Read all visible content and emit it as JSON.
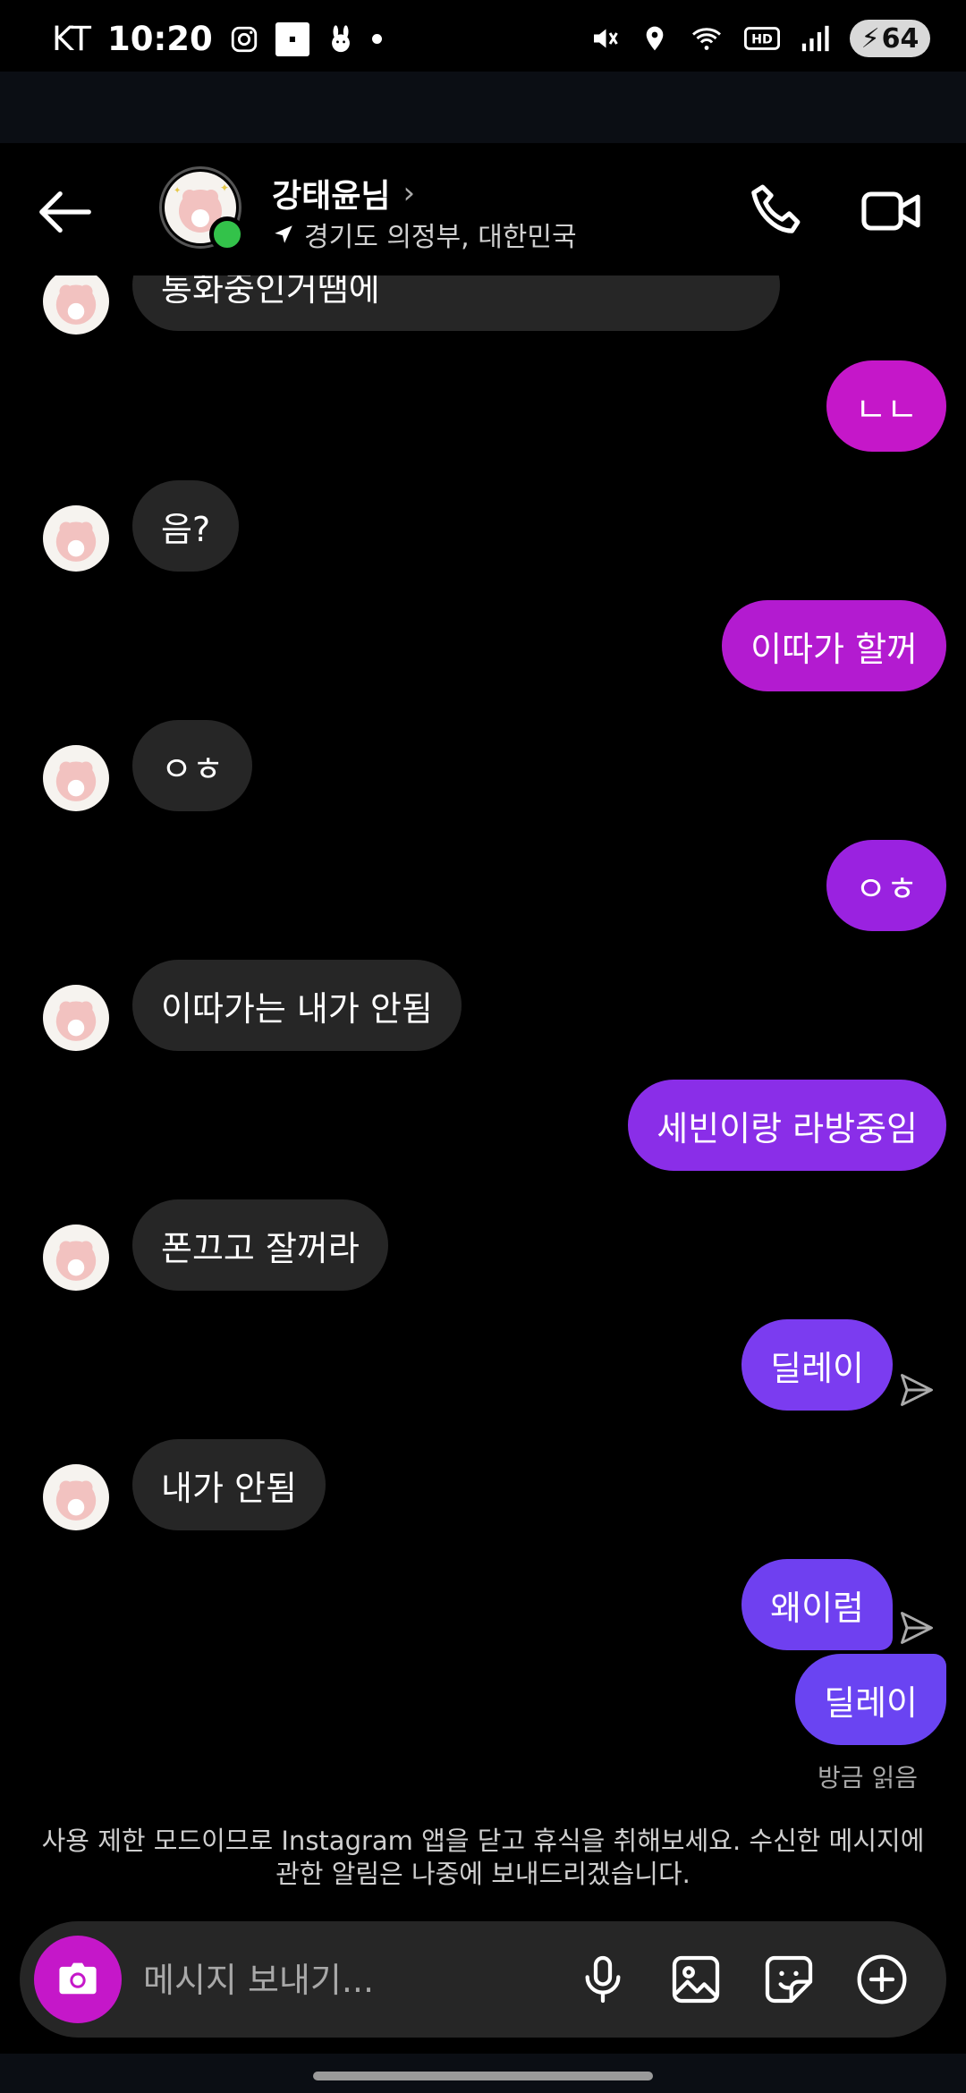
{
  "status_bar": {
    "carrier": "KT",
    "time": "10:20",
    "battery": "64"
  },
  "header": {
    "name": "강태윤님",
    "location": "경기도 의정부, 대한민국"
  },
  "messages": [
    {
      "from": "them",
      "text": "통화중인거땜에"
    },
    {
      "from": "me",
      "text": "ㄴㄴ"
    },
    {
      "from": "them",
      "text": "음?"
    },
    {
      "from": "me",
      "text": "이따가 할꺼"
    },
    {
      "from": "them",
      "text": "ㅇㅎ"
    },
    {
      "from": "me",
      "text": "ㅇㅎ"
    },
    {
      "from": "them",
      "text": "이따가는 내가 안됨"
    },
    {
      "from": "me",
      "text": "세빈이랑 라방중임"
    },
    {
      "from": "them",
      "text": "폰끄고 잘꺼라"
    },
    {
      "from": "me",
      "text": "딜레이"
    },
    {
      "from": "them",
      "text": "내가 안됨"
    },
    {
      "from": "me",
      "text": "왜이럼"
    },
    {
      "from": "me",
      "text": "딜레이"
    }
  ],
  "read_receipt": "방금 읽음",
  "notice": "사용 제한 모드이므로 Instagram 앱을 닫고 휴식을 취해보세요. 수신한 메시지에 관한 알림은 나중에 보내드리겠습니다.",
  "composer": {
    "placeholder": "메시지 보내기..."
  },
  "colors": {
    "outgoing_gradient": [
      "#c517c9",
      "#9a22e0",
      "#7b3cf0",
      "#6a44f2"
    ],
    "incoming_bubble": "#262626",
    "online": "#33c24a"
  },
  "icons": [
    "back-arrow-icon",
    "chevron-right-icon",
    "location-arrow-icon",
    "phone-icon",
    "video-camera-icon",
    "camera-icon",
    "microphone-icon",
    "gallery-icon",
    "sticker-icon",
    "plus-circle-icon",
    "send-icon"
  ]
}
